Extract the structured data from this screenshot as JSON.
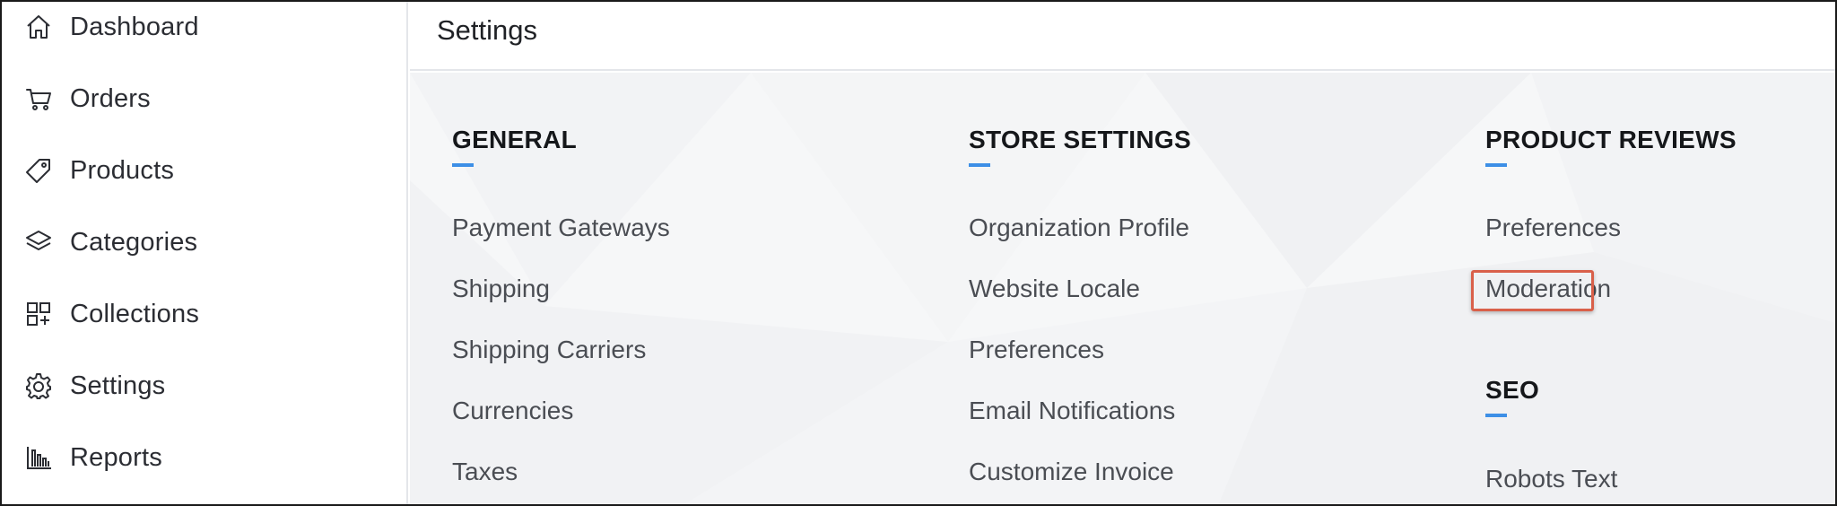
{
  "sidebar": {
    "items": [
      {
        "label": "Dashboard",
        "icon": "home-icon"
      },
      {
        "label": "Orders",
        "icon": "cart-icon"
      },
      {
        "label": "Products",
        "icon": "tag-icon"
      },
      {
        "label": "Categories",
        "icon": "layers-icon"
      },
      {
        "label": "Collections",
        "icon": "grid-plus-icon"
      },
      {
        "label": "Settings",
        "icon": "gear-icon"
      },
      {
        "label": "Reports",
        "icon": "bar-chart-icon"
      }
    ]
  },
  "header": {
    "title": "Settings"
  },
  "main": {
    "general": {
      "heading": "GENERAL",
      "links": [
        "Payment Gateways",
        "Shipping",
        "Shipping Carriers",
        "Currencies",
        "Taxes"
      ]
    },
    "store_settings": {
      "heading": "STORE SETTINGS",
      "links": [
        "Organization Profile",
        "Website Locale",
        "Preferences",
        "Email Notifications",
        "Customize Invoice"
      ]
    },
    "product_reviews": {
      "heading": "PRODUCT REVIEWS",
      "links": [
        "Preferences",
        "Moderation"
      ],
      "highlighted": "Moderation"
    },
    "seo": {
      "heading": "SEO",
      "links": [
        "Robots Text"
      ]
    }
  },
  "colors": {
    "accent": "#3d8fe6",
    "highlight_border": "#d9604a"
  }
}
